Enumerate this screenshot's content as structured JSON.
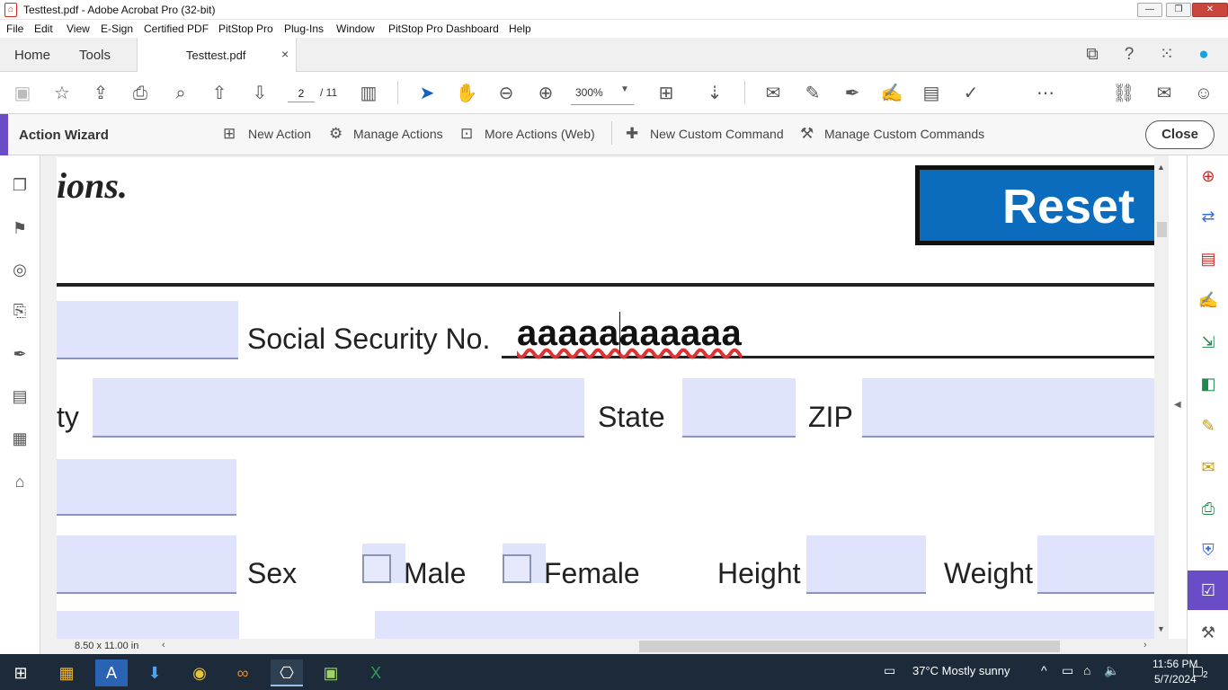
{
  "window": {
    "title": "Testtest.pdf - Adobe Acrobat Pro (32-bit)"
  },
  "menu": [
    "File",
    "Edit",
    "View",
    "E-Sign",
    "Certified PDF",
    "PitStop Pro",
    "Plug-Ins",
    "Window",
    "PitStop Pro Dashboard",
    "Help"
  ],
  "tabs": {
    "home": "Home",
    "tools": "Tools",
    "document": "Testtest.pdf",
    "close": "×"
  },
  "toolbar": {
    "page_current": "2",
    "page_total": "/ 11",
    "zoom": "300%"
  },
  "action_wizard": {
    "title": "Action Wizard",
    "items": [
      "New Action",
      "Manage Actions",
      "More Actions (Web)",
      "New Custom Command",
      "Manage Custom Commands"
    ],
    "close": "Close"
  },
  "pdf": {
    "heading_fragment": "ions.",
    "reset_button": "Reset",
    "ssn_label": "Social Security No.",
    "ssn_value": "aaaaaaaaaaa",
    "city_fragment": "ty",
    "state_label": "State",
    "zip_label": "ZIP",
    "sex_label": "Sex",
    "male_label": "Male",
    "female_label": "Female",
    "height_label": "Height",
    "weight_label": "Weight"
  },
  "statusbar": {
    "page_size": "8.50 x 11.00 in"
  },
  "taskbar": {
    "weather": "37°C  Mostly sunny",
    "time": "11:56 PM",
    "date": "5/7/2024",
    "notifications": "2"
  },
  "colors": {
    "accent": "#6a4cc7",
    "reset_blue": "#0b6bbd",
    "field_fill": "#dfe3fb",
    "taskbar": "#1c2a3a"
  }
}
